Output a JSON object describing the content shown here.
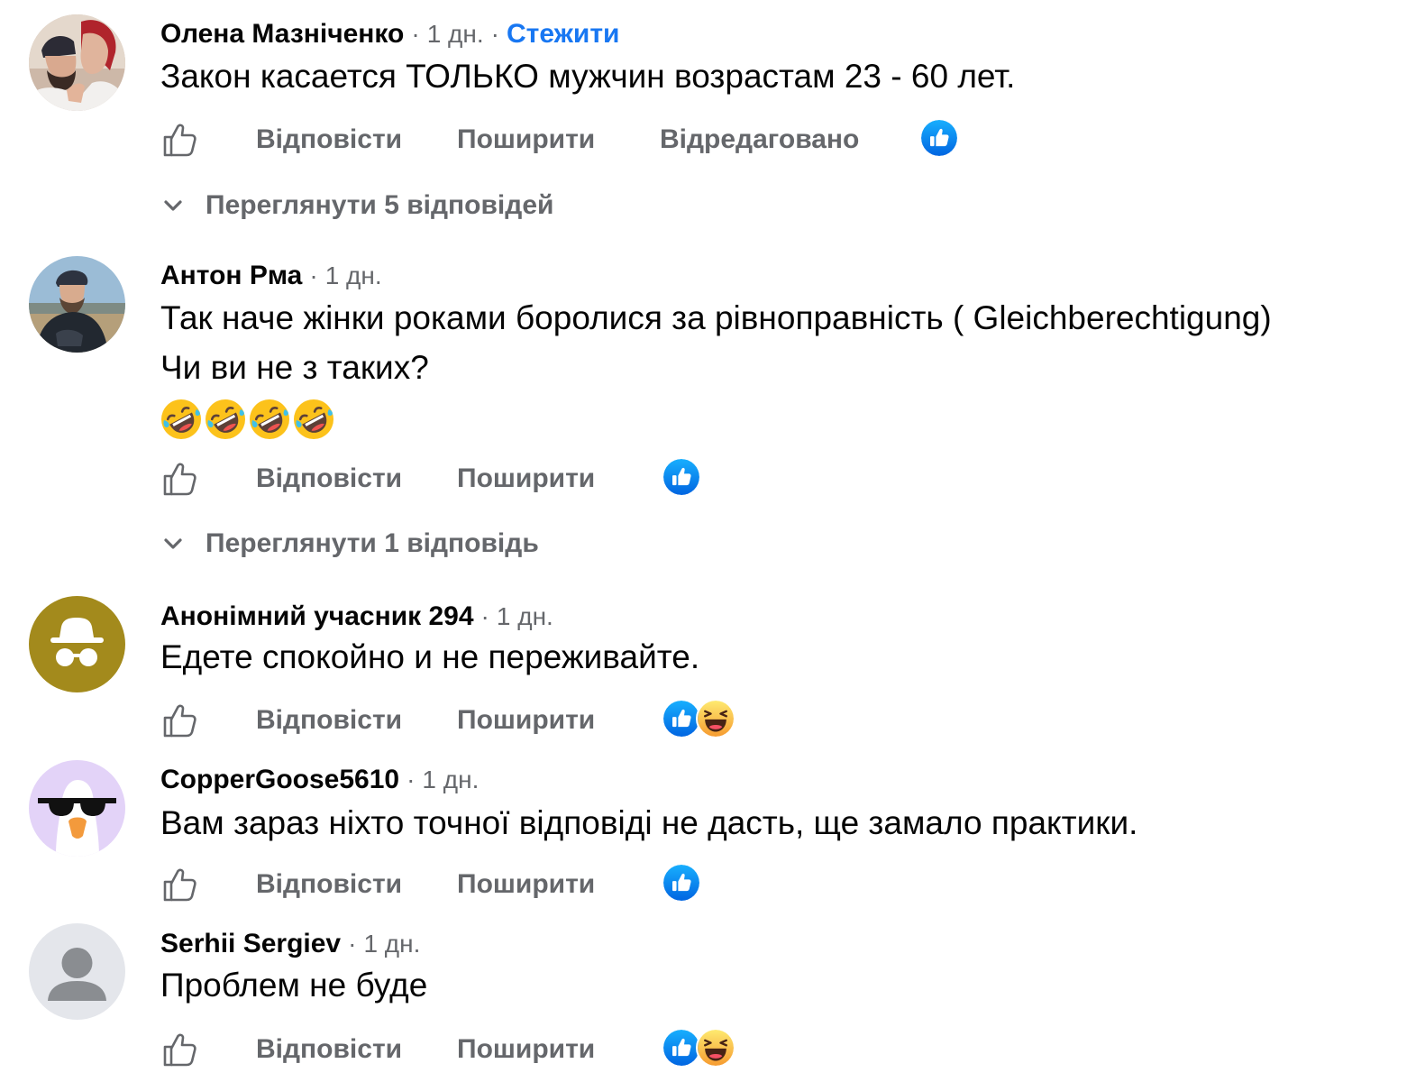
{
  "comments": [
    {
      "author": "Олена Мазніченко",
      "time": "1 дн.",
      "follow": "Стежити",
      "text_lines": [
        "Закон касается ТОЛЬКО мужчин возрастам 23 - 60 лет."
      ],
      "reply_label": "Відповісти",
      "share_label": "Поширити",
      "edited_label": "Відредаговано",
      "reactions": [
        "like"
      ],
      "view_replies": "Переглянути 5 відповідей"
    },
    {
      "author": "Антон Рма",
      "time": "1 дн.",
      "text_lines": [
        "Так наче жінки роками боролися за рівноправність ( Gleichberechtigung)",
        "Чи ви не з таких?"
      ],
      "emojis": [
        "rolling-on-floor-laughing",
        "rolling-on-floor-laughing",
        "rolling-on-floor-laughing",
        "rolling-on-floor-laughing"
      ],
      "reply_label": "Відповісти",
      "share_label": "Поширити",
      "reactions": [
        "like"
      ],
      "view_replies": "Переглянути 1 відповідь"
    },
    {
      "author": "Анонімний учасник 294",
      "time": "1 дн.",
      "text_lines": [
        "Едете спокойно и не переживайте."
      ],
      "reply_label": "Відповісти",
      "share_label": "Поширити",
      "reactions": [
        "like",
        "haha"
      ]
    },
    {
      "author": "CopperGoose5610",
      "time": "1 дн.",
      "text_lines": [
        "Вам зараз ніхто точної відповіді не дасть, ще замало практики."
      ],
      "reply_label": "Відповісти",
      "share_label": "Поширити",
      "reactions": [
        "like"
      ]
    },
    {
      "author": "Serhii Sergiev",
      "time": "1 дн.",
      "text_lines": [
        "Проблем не буде"
      ],
      "reply_label": "Відповісти",
      "share_label": "Поширити",
      "reactions": [
        "like",
        "haha"
      ]
    }
  ],
  "colors": {
    "link_blue": "#1877f2",
    "secondary_text": "#65676b",
    "primary_text": "#050505",
    "anon_avatar_bg": "#a38a1c",
    "goose_avatar_bg": "#e3d3f8",
    "default_avatar_bg": "#e4e6eb"
  }
}
